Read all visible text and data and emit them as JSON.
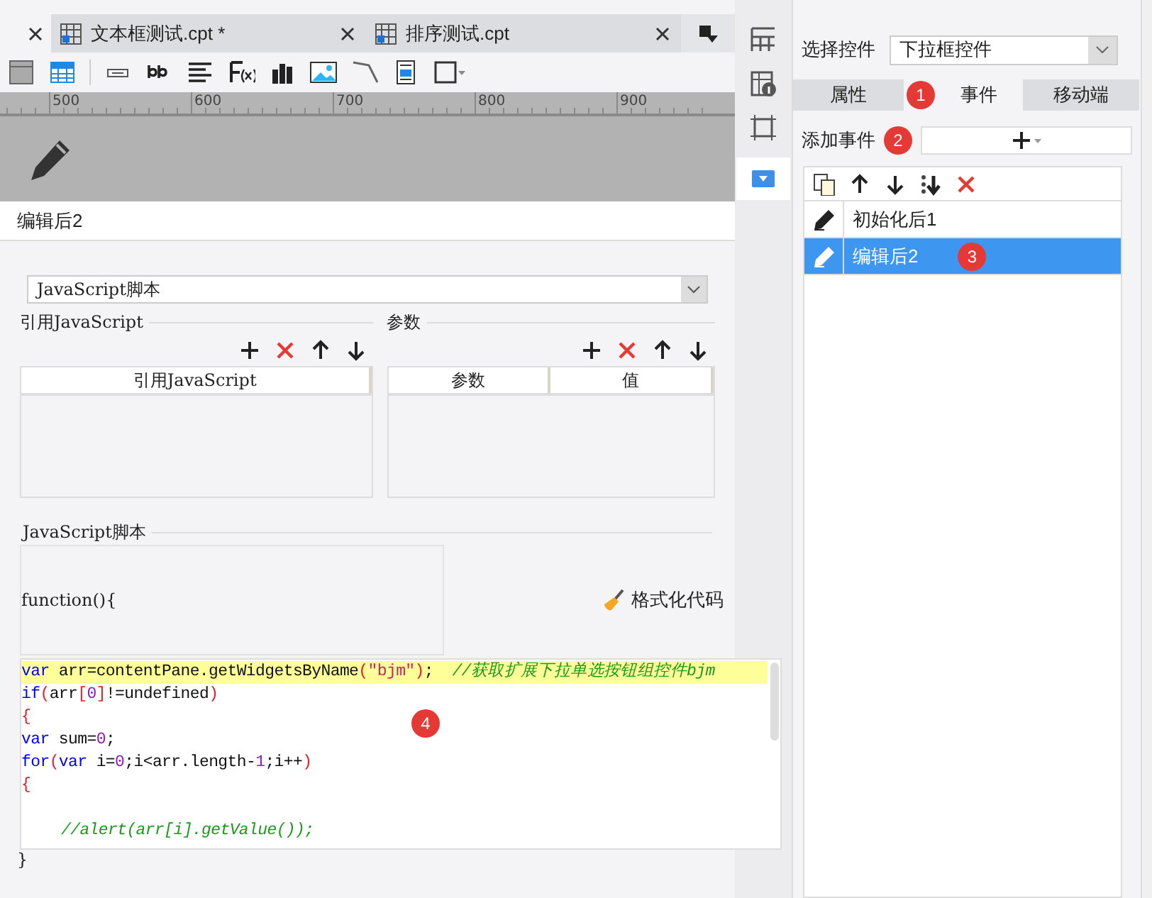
{
  "tabs": [
    {
      "label": "文本框测试.cpt *",
      "selected": false
    },
    {
      "label": "排序测试.cpt",
      "selected": false
    }
  ],
  "ruler": {
    "marks": [
      "500",
      "600",
      "700",
      "800",
      "900"
    ]
  },
  "dialog": {
    "title": "编辑后2",
    "script_type": "JavaScript脚本",
    "ref_section": {
      "title": "引用JavaScript",
      "columns": [
        "引用JavaScript"
      ]
    },
    "param_section": {
      "title": "参数",
      "columns": [
        "参数",
        "值"
      ]
    },
    "script_section": {
      "title": "JavaScript脚本",
      "signature": "function(){",
      "format_button": "格式化代码",
      "closing": "}",
      "code_lines": [
        {
          "highlighted": true,
          "tokens": [
            {
              "kind": "keyword",
              "text": "var"
            },
            {
              "kind": "plain",
              "text": " arr=contentPane.getWidgetsByName"
            },
            {
              "kind": "paren",
              "text": "("
            },
            {
              "kind": "string",
              "text": "\"bjm\""
            },
            {
              "kind": "paren",
              "text": ")"
            },
            {
              "kind": "plain",
              "text": ";  "
            },
            {
              "kind": "comment",
              "text": "//获取扩展下拉单选按钮组控件bjm"
            }
          ]
        },
        {
          "highlighted": false,
          "tokens": [
            {
              "kind": "keyword",
              "text": "if"
            },
            {
              "kind": "paren",
              "text": "("
            },
            {
              "kind": "plain",
              "text": "arr"
            },
            {
              "kind": "paren",
              "text": "["
            },
            {
              "kind": "number",
              "text": "0"
            },
            {
              "kind": "paren",
              "text": "]"
            },
            {
              "kind": "plain",
              "text": "!=undefined"
            },
            {
              "kind": "paren",
              "text": ")"
            }
          ]
        },
        {
          "highlighted": false,
          "tokens": [
            {
              "kind": "paren",
              "text": "{"
            }
          ]
        },
        {
          "highlighted": false,
          "tokens": [
            {
              "kind": "keyword",
              "text": "var"
            },
            {
              "kind": "plain",
              "text": " sum="
            },
            {
              "kind": "number",
              "text": "0"
            },
            {
              "kind": "plain",
              "text": ";"
            }
          ]
        },
        {
          "highlighted": false,
          "tokens": [
            {
              "kind": "keyword",
              "text": "for"
            },
            {
              "kind": "paren",
              "text": "("
            },
            {
              "kind": "keyword",
              "text": "var"
            },
            {
              "kind": "plain",
              "text": " i="
            },
            {
              "kind": "number",
              "text": "0"
            },
            {
              "kind": "plain",
              "text": ";i<arr.length-"
            },
            {
              "kind": "number",
              "text": "1"
            },
            {
              "kind": "plain",
              "text": ";i++"
            },
            {
              "kind": "paren",
              "text": ")"
            }
          ]
        },
        {
          "highlighted": false,
          "tokens": [
            {
              "kind": "paren",
              "text": "{"
            }
          ]
        },
        {
          "highlighted": false
        },
        {
          "highlighted": false,
          "indent": true,
          "tokens": [
            {
              "kind": "comment",
              "text": "//alert(arr[i].getValue());"
            }
          ]
        }
      ]
    }
  },
  "settings": {
    "select_label": "选择控件",
    "select_value": "下拉框控件",
    "tabs": [
      {
        "label": "属性",
        "selected": false
      },
      {
        "label": "事件",
        "selected": true
      },
      {
        "label": "移动端",
        "selected": false
      }
    ],
    "add_event_label": "添加事件",
    "events": [
      {
        "label": "初始化后1",
        "selected": false
      },
      {
        "label": "编辑后2",
        "selected": true
      }
    ]
  },
  "annotations": [
    "1",
    "2",
    "3",
    "4"
  ]
}
